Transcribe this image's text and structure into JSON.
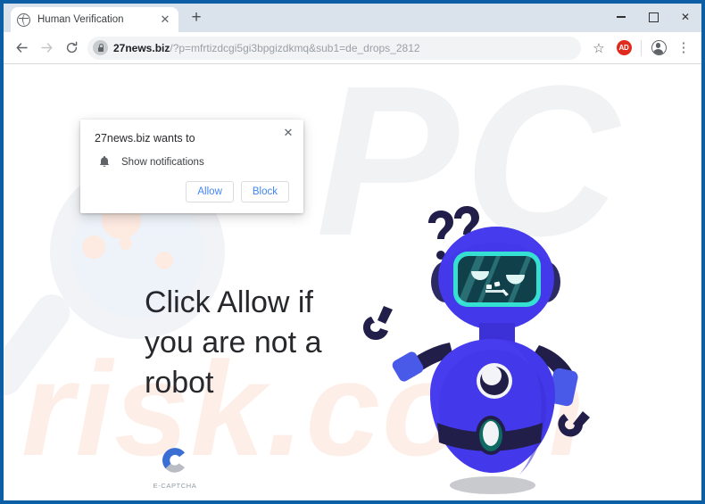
{
  "window": {
    "controls": {
      "minimize": "–",
      "maximize": "□",
      "close": "✕"
    },
    "frame_color": "#0c5fa4"
  },
  "browser": {
    "tab": {
      "title": "Human Verification",
      "favicon": "globe-icon",
      "close_label": "✕"
    },
    "new_tab_label": "+",
    "toolbar": {
      "back_label": "←",
      "forward_label": "→",
      "reload_label": "⟳",
      "url_host": "27news.biz",
      "url_path": "/?p=mfrtizdcgi5gi3bpgizdkmq&sub1=de_drops_2812",
      "url_full": "27news.biz/?p=mfrtizdcgi5gi3bpgizdkmq&sub1=de_drops_2812",
      "bookmark_label": "☆",
      "adblock_label": "AD",
      "menu_label": "⋮"
    }
  },
  "popup": {
    "title": "27news.biz wants to",
    "permission": "Show notifications",
    "permission_icon": "bell-icon",
    "allow_label": "Allow",
    "block_label": "Block",
    "close_label": "✕",
    "link_color": "#4285f4"
  },
  "page": {
    "headline": "Click Allow if you are not a robot",
    "captcha_label": "E-CAPTCHA",
    "watermark_top": "PC",
    "watermark_bottom": "risk.com",
    "colors": {
      "robot_body": "#4338ea",
      "robot_dark": "#211f49",
      "visor_border": "#35e0d2",
      "visor_fill": "#10414a",
      "watermark_top_color": "#f1f2f3",
      "watermark_bottom_color": "#fdeee7",
      "headline_color": "#27282c"
    }
  }
}
